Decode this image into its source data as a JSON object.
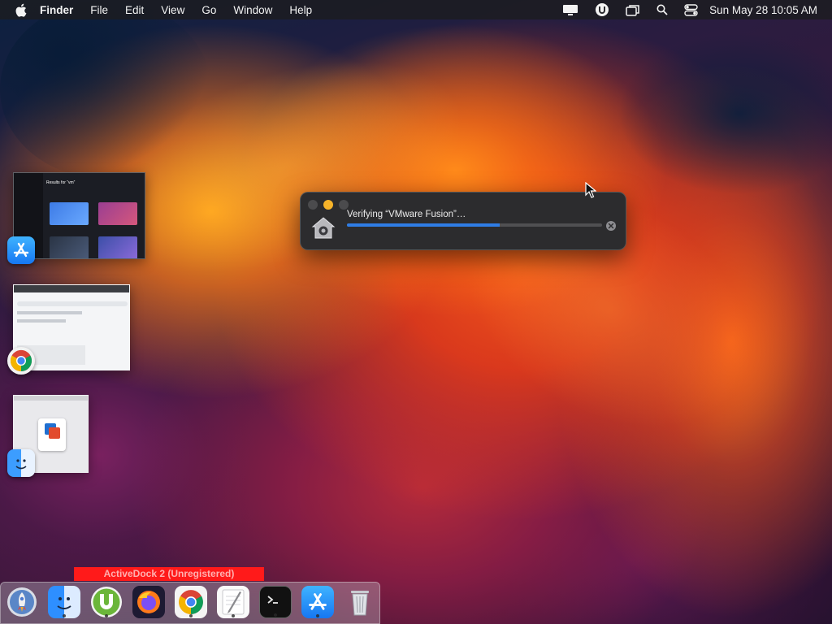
{
  "menubar": {
    "app_name": "Finder",
    "items": [
      "File",
      "Edit",
      "View",
      "Go",
      "Window",
      "Help"
    ],
    "clock": "Sun May 28  10:05 AM"
  },
  "verify_window": {
    "message": "Verifying “VMware Fusion”…",
    "progress": 0.6
  },
  "thumbnails": {
    "appstore": {
      "title": "Results for “vm”"
    }
  },
  "dock": {
    "label": "ActiveDock 2 (Unregistered)",
    "apps": [
      {
        "name": "Launchpad",
        "running": false
      },
      {
        "name": "Finder",
        "running": true
      },
      {
        "name": "uTorrent",
        "running": true
      },
      {
        "name": "Firefox",
        "running": false
      },
      {
        "name": "Google Chrome",
        "running": true
      },
      {
        "name": "TextEdit",
        "running": true
      },
      {
        "name": "Terminal",
        "running": true
      },
      {
        "name": "App Store",
        "running": true
      },
      {
        "name": "Trash",
        "running": false
      }
    ]
  },
  "colors": {
    "accent_blue": "#2f7de5",
    "dock_label_red": "#ff1a1a",
    "minimize_yellow": "#f6b329"
  }
}
